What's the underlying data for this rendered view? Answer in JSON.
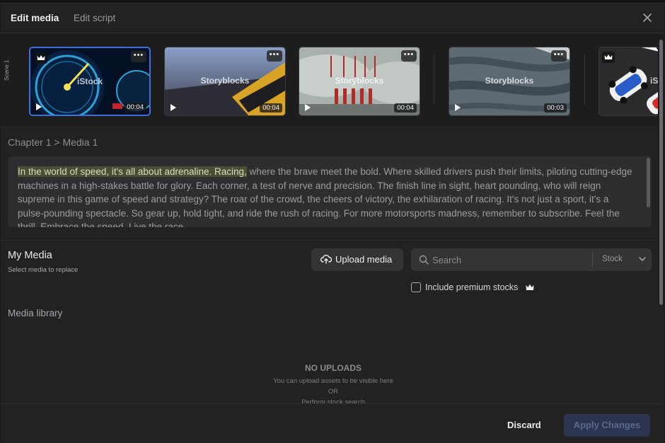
{
  "header": {
    "tabs": [
      {
        "label": "Edit media",
        "active": true
      },
      {
        "label": "Edit script",
        "active": false
      }
    ],
    "close_icon": "close-icon"
  },
  "scene_strip": {
    "scene_label": "Scene 1",
    "thumbnails": [
      {
        "watermark": "iStock",
        "duration": "00:04",
        "selected": true,
        "premium": true
      },
      {
        "watermark": "Storyblocks",
        "duration": "00:04",
        "selected": false,
        "premium": false
      },
      {
        "watermark": "Storyblocks",
        "duration": "00:04",
        "selected": false,
        "premium": false
      },
      {
        "watermark": "Storyblocks",
        "duration": "00:03",
        "selected": false,
        "premium": false
      },
      {
        "watermark": "iSt",
        "duration": "",
        "selected": false,
        "premium": true
      }
    ]
  },
  "breadcrumb": "Chapter 1 > Media 1",
  "script": {
    "highlighted": "In the world of speed, it's all about adrenaline. Racing,",
    "rest": " where the brave meet the bold. Where skilled drivers push their limits, piloting cutting-edge machines in a high-stakes battle for glory. Each corner, a test of nerve and precision. The finish line in sight, heart pounding, who will reign supreme in this game of speed and strategy? The roar of the crowd, the cheers of victory, the exhilaration of racing. It's not just a sport, it's a pulse-pounding spectacle. So gear up, hold tight, and ride the rush of racing. For more motorsports madness, remember to subscribe. Feel the thrill. Embrace the speed. Live the race."
  },
  "my_media": {
    "title": "My Media",
    "subtitle": "Select media to replace",
    "upload_label": "Upload media",
    "search_placeholder": "Search",
    "source_selected": "Stock",
    "premium_label": "Include premium stocks",
    "premium_checked": false
  },
  "library": {
    "title": "Media library",
    "empty_title": "NO UPLOADS",
    "empty_line1": "You can upload assets to be visible here",
    "empty_or": "OR",
    "empty_line2": "Perform stock search"
  },
  "footer": {
    "discard_label": "Discard",
    "apply_label": "Apply Changes"
  },
  "colors": {
    "accent_selected": "#3f6fd8",
    "apply_button_disabled": "#2b3550",
    "script_highlight": "#4a4f33"
  }
}
